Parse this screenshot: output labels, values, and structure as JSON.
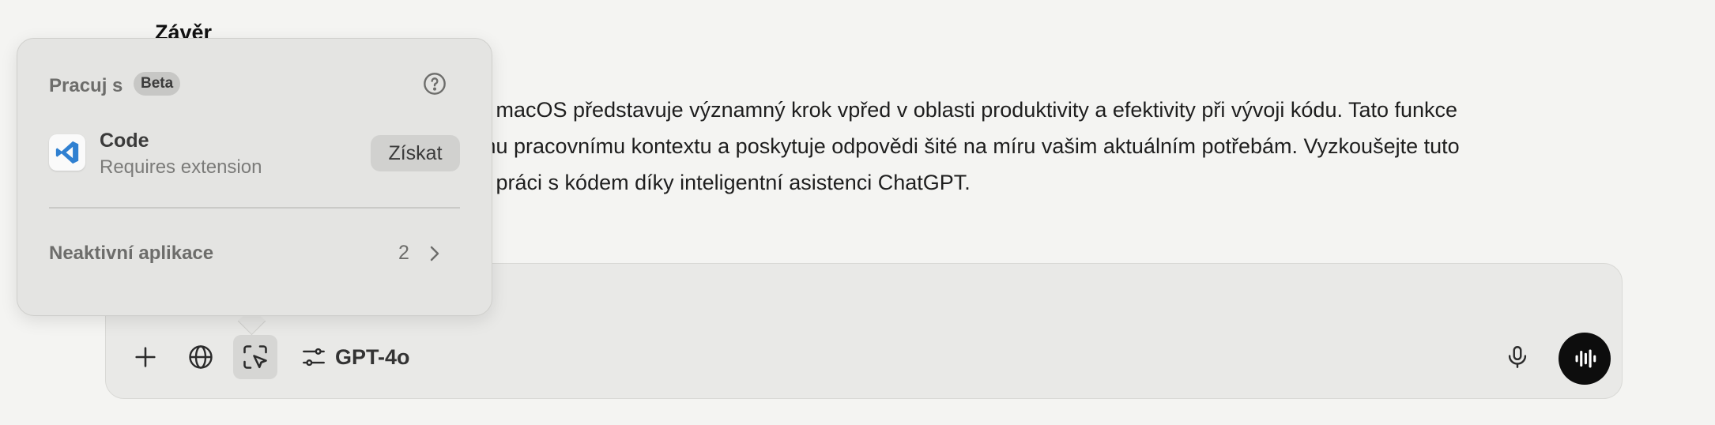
{
  "chat": {
    "heading": "Závěr",
    "paragraph_lines": [
      "na macOS představuje významný krok vpřed v oblasti produktivity a efektivity při vývoji kódu. Tato funkce",
      "emu pracovnímu kontextu a poskytuje odpovědi šité na míru vašim aktuálním potřebám. Vyzkoušejte tuto",
      "ou práci s kódem díky inteligentní asistenci ChatGPT."
    ]
  },
  "popover": {
    "title": "Pracuj s",
    "badge": "Beta",
    "help_icon": "question-circle-icon",
    "app": {
      "icon": "vscode-icon",
      "name": "Code",
      "subtitle": "Requires extension",
      "action_label": "Získat"
    },
    "inactive": {
      "label": "Neaktivní aplikace",
      "count": "2",
      "icon": "chevron-right-icon"
    }
  },
  "composer": {
    "tools": [
      {
        "icon": "plus-icon"
      },
      {
        "icon": "globe-icon"
      },
      {
        "icon": "work-with-apps-icon",
        "active": true
      },
      {
        "icon": "sliders-icon"
      }
    ],
    "model_label": "GPT-4o",
    "mic_icon": "microphone-icon",
    "voice_icon": "voice-mode-icon"
  },
  "colors": {
    "background": "#f4f4f2",
    "composer": "#e9e9e7",
    "popover": "#e4e4e2",
    "voice_button": "#0d0d0d",
    "vscode_blue": "#2f80d1"
  }
}
